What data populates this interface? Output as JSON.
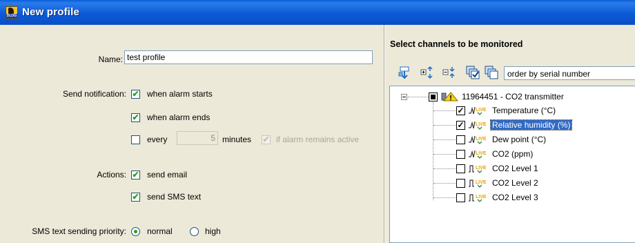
{
  "window": {
    "title": "New profile"
  },
  "form": {
    "name_label": "Name:",
    "name_value": "test profile",
    "send_notification_label": "Send notification:",
    "when_alarm_starts": {
      "label": "when alarm starts",
      "checked": true
    },
    "when_alarm_ends": {
      "label": "when alarm ends",
      "checked": true
    },
    "every": {
      "label": "every",
      "checked": false,
      "value": "5",
      "unit_label": "minutes"
    },
    "if_alarm_remains_active": {
      "label": "if alarm remains active",
      "checked": true,
      "disabled": true
    },
    "actions_label": "Actions:",
    "send_email": {
      "label": "send email",
      "checked": true
    },
    "send_sms": {
      "label": "send SMS text",
      "checked": true
    },
    "sms_priority_label": "SMS text sending priority:",
    "priority_options": [
      {
        "label": "normal",
        "selected": true
      },
      {
        "label": "high",
        "selected": false
      }
    ]
  },
  "channels": {
    "title": "Select channels to be monitored",
    "toolbar_icons": [
      "move-up-icon",
      "expand-all-icon",
      "collapse-all-icon",
      "select-all-icon",
      "deselect-all-icon"
    ],
    "order_select_value": "order by serial number",
    "device": {
      "label": "11964451 - CO2 transmitter"
    },
    "items": [
      {
        "label": "Temperature (°C)",
        "checked": true,
        "icon": "analog-live-icon",
        "selected": false
      },
      {
        "label": "Relative humidity (%)",
        "checked": true,
        "icon": "analog-live-icon",
        "selected": true
      },
      {
        "label": "Dew point (°C)",
        "checked": false,
        "icon": "analog-live-icon",
        "selected": false
      },
      {
        "label": "CO2 (ppm)",
        "checked": false,
        "icon": "analog-live-icon",
        "selected": false
      },
      {
        "label": "CO2 Level 1",
        "checked": false,
        "icon": "binary-live-icon",
        "selected": false
      },
      {
        "label": "CO2 Level 2",
        "checked": false,
        "icon": "binary-live-icon",
        "selected": false
      },
      {
        "label": "CO2 Level 3",
        "checked": false,
        "icon": "binary-live-icon",
        "selected": false
      }
    ],
    "live_tag": "LIVE"
  },
  "colors": {
    "titlebar": "#0a5fd8",
    "selection": "#316ac5",
    "check": "#21a121",
    "live": "#e8a400"
  }
}
